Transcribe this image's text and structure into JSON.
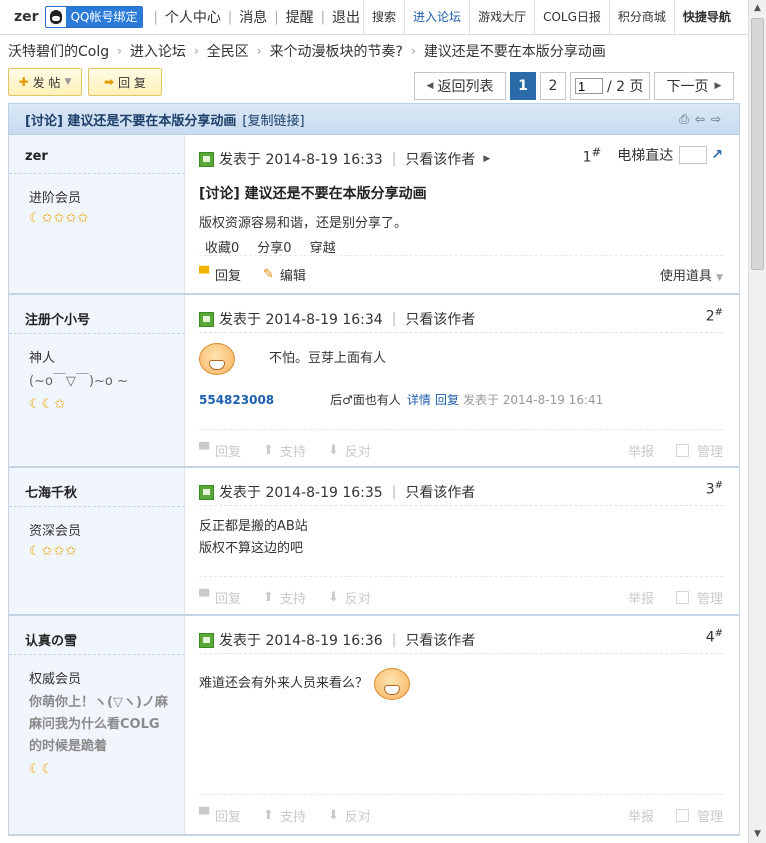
{
  "topbar": {
    "username": "zer",
    "qq_bind": "QQ帐号绑定",
    "nav": [
      "个人中心",
      "消息",
      "提醒",
      "退出"
    ],
    "right_nav": [
      "搜索",
      "进入论坛",
      "游戏大厅",
      "COLG日报",
      "积分商城",
      "快捷导航"
    ]
  },
  "breadcrumb": [
    "沃特碧们的Colg",
    "进入论坛",
    "全民区",
    "来个动漫板块的节奏?",
    "建议还是不要在本版分享动画"
  ],
  "actions": {
    "post": "发 帖",
    "reply": "回 复"
  },
  "pager": {
    "back": "返回列表",
    "pages": [
      "1",
      "2"
    ],
    "current": "1",
    "input_value": "1",
    "total": "/ 2 页",
    "next": "下一页"
  },
  "thread": {
    "title": "[讨论] 建议还是不要在本版分享动画",
    "copy_link": "[复制链接]"
  },
  "posts": [
    {
      "author": "zer",
      "rank": "进阶会员",
      "stars": "☾✩✩✩✩",
      "posted": "发表于 2014-8-19 16:33",
      "only_author": "只看该作者",
      "floor": "1",
      "floor_mark": "#",
      "elevator": "电梯直达",
      "title": "[讨论] 建议还是不要在本版分享动画",
      "text": "版权资源容易和谐，还是别分享了。",
      "counts": [
        "收藏0",
        "分享0",
        "穿越"
      ],
      "ops": [
        "回复",
        "编辑"
      ],
      "tool": "使用道具"
    },
    {
      "author": "注册个小号",
      "rank": "神人",
      "signature": "(~o￣▽￣)~o ~",
      "stars": "☾☾✩",
      "posted": "发表于 2014-8-19 16:34",
      "only_author": "只看该作者",
      "floor": "2",
      "floor_mark": "#",
      "text": "不怕。豆芽上面有人",
      "quote": {
        "uid": "554823008",
        "text": "后♂面也有人",
        "detail": "详情",
        "reply": "回复",
        "time": "发表于 2014-8-19 16:41"
      },
      "ops": [
        "回复",
        "支持",
        "反对"
      ],
      "report": "举报",
      "manage": "管理"
    },
    {
      "author": "七海千秋",
      "rank": "资深会员",
      "stars": "☾✩✩✩",
      "posted": "发表于 2014-8-19 16:35",
      "only_author": "只看该作者",
      "floor": "3",
      "floor_mark": "#",
      "text_lines": [
        "反正都是搬的AB站",
        "版权不算这边的吧"
      ],
      "ops": [
        "回复",
        "支持",
        "反对"
      ],
      "report": "举报",
      "manage": "管理"
    },
    {
      "author": "认真の雪",
      "rank": "权威会员",
      "signature_lines": [
        "你萌你上！ヽ(▽ヽ)ノ麻",
        "麻问我为什么看COLG",
        "的时候是跪着"
      ],
      "stars": "☾☾",
      "posted": "发表于 2014-8-19 16:36",
      "only_author": "只看该作者",
      "floor": "4",
      "floor_mark": "#",
      "text": "难道还会有外来人员来看么？",
      "ops": [
        "回复",
        "支持",
        "反对"
      ],
      "report": "举报",
      "manage": "管理"
    }
  ]
}
